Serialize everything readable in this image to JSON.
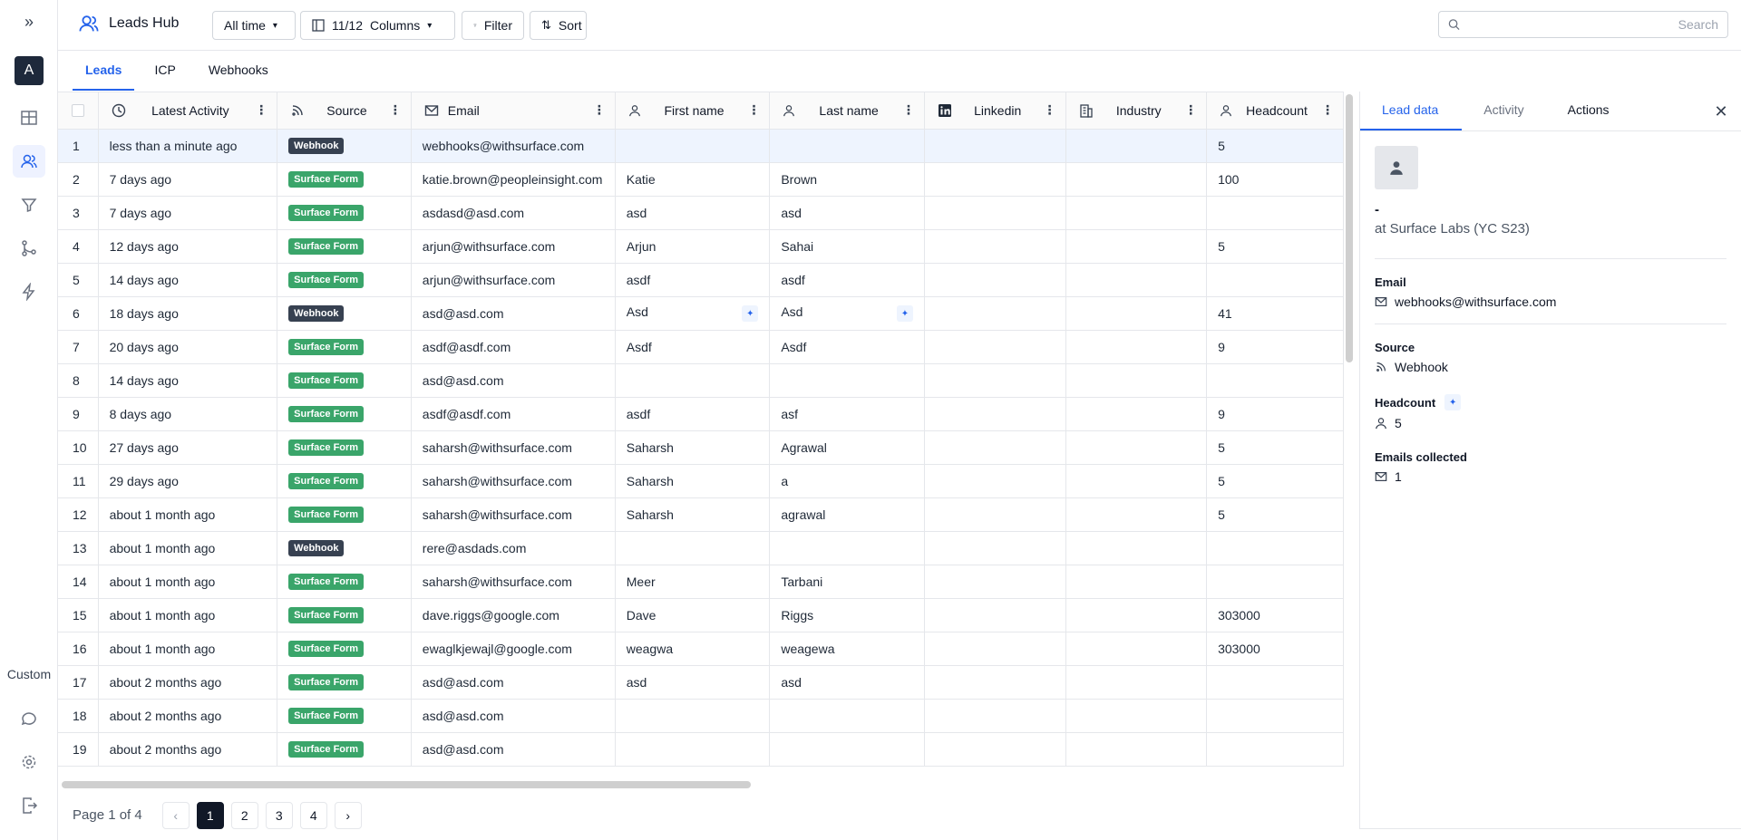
{
  "app": {
    "title": "Leads Hub",
    "avatar_letter": "A",
    "custom_label": "Custom"
  },
  "toolbar": {
    "time_filter": "All time",
    "columns_count": "11/12",
    "columns_label": "Columns",
    "filter_label": "Filter",
    "sort_label": "Sort",
    "search_placeholder": "Search"
  },
  "tabs": [
    {
      "label": "Leads",
      "active": true
    },
    {
      "label": "ICP",
      "active": false
    },
    {
      "label": "Webhooks",
      "active": false
    }
  ],
  "table": {
    "columns": [
      {
        "label": "Latest Activity",
        "icon": "clock-icon"
      },
      {
        "label": "Source",
        "icon": "rss-icon"
      },
      {
        "label": "Email",
        "icon": "mail-icon"
      },
      {
        "label": "First name",
        "icon": "user-icon"
      },
      {
        "label": "Last name",
        "icon": "user-icon"
      },
      {
        "label": "Linkedin",
        "icon": "linkedin-icon"
      },
      {
        "label": "Industry",
        "icon": "building-icon"
      },
      {
        "label": "Headcount",
        "icon": "user-icon"
      }
    ],
    "rows": [
      {
        "n": "1",
        "activity": "less than a minute ago",
        "source": "Webhook",
        "email": "webhooks@withsurface.com",
        "first": "",
        "last": "",
        "linkedin": "",
        "industry": "",
        "headcount": "5"
      },
      {
        "n": "2",
        "activity": "7 days ago",
        "source": "Surface Form",
        "email": "katie.brown@peopleinsight.com",
        "first": "Katie",
        "last": "Brown",
        "linkedin": "",
        "industry": "",
        "headcount": "100"
      },
      {
        "n": "3",
        "activity": "7 days ago",
        "source": "Surface Form",
        "email": "asdasd@asd.com",
        "first": "asd",
        "last": "asd",
        "linkedin": "",
        "industry": "",
        "headcount": ""
      },
      {
        "n": "4",
        "activity": "12 days ago",
        "source": "Surface Form",
        "email": "arjun@withsurface.com",
        "first": "Arjun",
        "last": "Sahai",
        "linkedin": "",
        "industry": "",
        "headcount": "5"
      },
      {
        "n": "5",
        "activity": "14 days ago",
        "source": "Surface Form",
        "email": "arjun@withsurface.com",
        "first": "asdf",
        "last": "asdf",
        "linkedin": "",
        "industry": "",
        "headcount": ""
      },
      {
        "n": "6",
        "activity": "18 days ago",
        "source": "Webhook",
        "email": "asd@asd.com",
        "first": "Asd",
        "last": "Asd",
        "linkedin": "",
        "industry": "",
        "headcount": "41"
      },
      {
        "n": "7",
        "activity": "20 days ago",
        "source": "Surface Form",
        "email": "asdf@asdf.com",
        "first": "Asdf",
        "last": "Asdf",
        "linkedin": "",
        "industry": "",
        "headcount": "9"
      },
      {
        "n": "8",
        "activity": "14 days ago",
        "source": "Surface Form",
        "email": "asd@asd.com",
        "first": "",
        "last": "",
        "linkedin": "",
        "industry": "",
        "headcount": ""
      },
      {
        "n": "9",
        "activity": "8 days ago",
        "source": "Surface Form",
        "email": "asdf@asdf.com",
        "first": "asdf",
        "last": "asf",
        "linkedin": "",
        "industry": "",
        "headcount": "9"
      },
      {
        "n": "10",
        "activity": "27 days ago",
        "source": "Surface Form",
        "email": "saharsh@withsurface.com",
        "first": "Saharsh",
        "last": "Agrawal",
        "linkedin": "",
        "industry": "",
        "headcount": "5"
      },
      {
        "n": "11",
        "activity": "29 days ago",
        "source": "Surface Form",
        "email": "saharsh@withsurface.com",
        "first": "Saharsh",
        "last": "a",
        "linkedin": "",
        "industry": "",
        "headcount": "5"
      },
      {
        "n": "12",
        "activity": "about 1 month ago",
        "source": "Surface Form",
        "email": "saharsh@withsurface.com",
        "first": "Saharsh",
        "last": "agrawal",
        "linkedin": "",
        "industry": "",
        "headcount": "5"
      },
      {
        "n": "13",
        "activity": "about 1 month ago",
        "source": "Webhook",
        "email": "rere@asdads.com",
        "first": "",
        "last": "",
        "linkedin": "",
        "industry": "",
        "headcount": ""
      },
      {
        "n": "14",
        "activity": "about 1 month ago",
        "source": "Surface Form",
        "email": "saharsh@withsurface.com",
        "first": "Meer",
        "last": "Tarbani",
        "linkedin": "",
        "industry": "",
        "headcount": ""
      },
      {
        "n": "15",
        "activity": "about 1 month ago",
        "source": "Surface Form",
        "email": "dave.riggs@google.com",
        "first": "Dave",
        "last": "Riggs",
        "linkedin": "",
        "industry": "",
        "headcount": "303000"
      },
      {
        "n": "16",
        "activity": "about 1 month ago",
        "source": "Surface Form",
        "email": "ewaglkjewajl@google.com",
        "first": "weagwa",
        "last": "weagewa",
        "linkedin": "",
        "industry": "",
        "headcount": "303000"
      },
      {
        "n": "17",
        "activity": "about 2 months ago",
        "source": "Surface Form",
        "email": "asd@asd.com",
        "first": "asd",
        "last": "asd",
        "linkedin": "",
        "industry": "",
        "headcount": ""
      },
      {
        "n": "18",
        "activity": "about 2 months ago",
        "source": "Surface Form",
        "email": "asd@asd.com",
        "first": "",
        "last": "",
        "linkedin": "",
        "industry": "",
        "headcount": ""
      },
      {
        "n": "19",
        "activity": "about 2 months ago",
        "source": "Surface Form",
        "email": "asd@asd.com",
        "first": "",
        "last": "",
        "linkedin": "",
        "industry": "",
        "headcount": ""
      }
    ]
  },
  "pagination": {
    "info": "Page 1 of 4",
    "pages": [
      "1",
      "2",
      "3",
      "4"
    ],
    "current": "1"
  },
  "panel": {
    "tabs": [
      "Lead data",
      "Activity",
      "Actions"
    ],
    "name": "-",
    "company": "at Surface Labs (YC S23)",
    "email_label": "Email",
    "email_value": "webhooks@withsurface.com",
    "source_label": "Source",
    "source_value": "Webhook",
    "headcount_label": "Headcount",
    "headcount_value": "5",
    "emails_collected_label": "Emails collected",
    "emails_collected_value": "1"
  },
  "colors": {
    "accent": "#2563eb",
    "webhook_badge": "#374151",
    "form_badge": "#3aa56a",
    "selected_row": "#eef4fe"
  }
}
